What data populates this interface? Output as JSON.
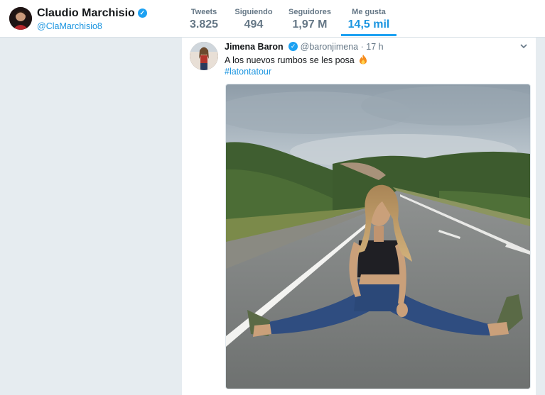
{
  "profile": {
    "name": "Claudio Marchisio",
    "handle": "@ClaMarchisio8",
    "verified_icon": "verified-badge-icon"
  },
  "stats": [
    {
      "label": "Tweets",
      "value": "3.825"
    },
    {
      "label": "Siguiendo",
      "value": "494"
    },
    {
      "label": "Seguidores",
      "value": "1,97 M"
    },
    {
      "label": "Me gusta",
      "value": "14,5 mil",
      "active": true
    }
  ],
  "tweet": {
    "author_name": "Jimena Baron",
    "author_handle": "@baronjimena",
    "separator": "·",
    "time": "17 h",
    "text": "A los nuevos rumbos se les posa",
    "emoji_icon": "fire-icon",
    "hashtag": "#latontatour",
    "menu_icon": "chevron-down-icon"
  },
  "colors": {
    "accent": "#1da1f2",
    "link": "#1b95e0",
    "page_bg": "#e6ecf0"
  }
}
